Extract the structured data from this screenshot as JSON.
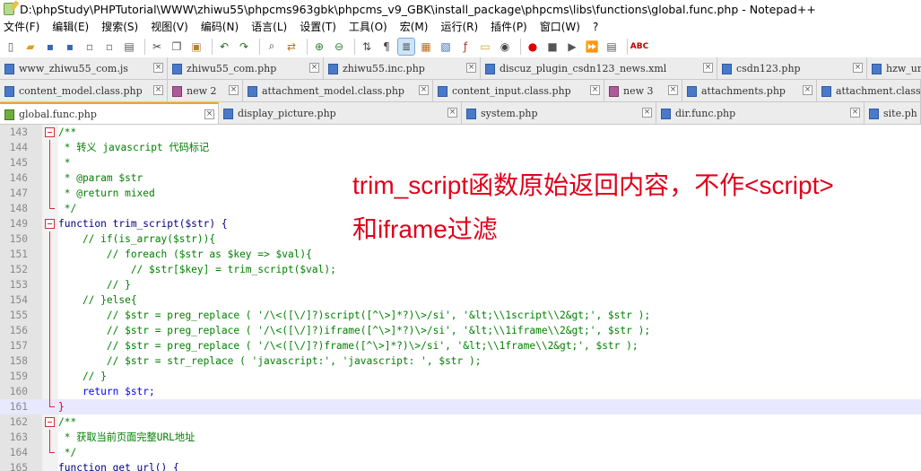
{
  "window": {
    "title": "D:\\phpStudy\\PHPTutorial\\WWW\\zhiwu55\\phpcms963gbk\\phpcms_v9_GBK\\install_package\\phpcms\\libs\\functions\\global.func.php - Notepad++"
  },
  "menu": {
    "items": [
      "文件(F)",
      "编辑(E)",
      "搜索(S)",
      "视图(V)",
      "编码(N)",
      "语言(L)",
      "设置(T)",
      "工具(O)",
      "宏(M)",
      "运行(R)",
      "插件(P)",
      "窗口(W)",
      "?"
    ]
  },
  "toolbar": {
    "icons": [
      "new-file-icon",
      "open-file-icon",
      "save-icon",
      "save-all-icon",
      "close-icon",
      "close-all-icon",
      "print-icon",
      "cut-icon",
      "copy-icon",
      "paste-icon",
      "undo-icon",
      "redo-icon",
      "find-icon",
      "replace-icon",
      "zoom-in-icon",
      "zoom-out-icon",
      "sync-v-icon",
      "sync-h-icon",
      "wrap-icon",
      "show-all-icon",
      "indent-guide-icon",
      "lang-icon",
      "doc-map-icon",
      "function-list-icon",
      "folder-icon",
      "monitor-icon",
      "record-icon",
      "stop-icon",
      "play-icon",
      "play-multi-icon",
      "save-macro-icon",
      "spellcheck-icon"
    ]
  },
  "tabs": {
    "row1": [
      "www_zhiwu55_com.js",
      "zhiwu55_com.php",
      "zhiwu55.inc.php",
      "discuz_plugin_csdn123_news.xml",
      "csdn123.php",
      "hzw_url_a"
    ],
    "row2": [
      "content_model.class.php",
      "new 2",
      "attachment_model.class.php",
      "content_input.class.php",
      "new 3",
      "attachments.php",
      "attachment.class"
    ],
    "row3": [
      "global.func.php",
      "display_picture.php",
      "system.php",
      "dir.func.php",
      "site.ph"
    ]
  },
  "editor": {
    "lines": [
      {
        "n": "143",
        "t": "/**"
      },
      {
        "n": "144",
        "t": " * 转义 javascript 代码标记"
      },
      {
        "n": "145",
        "t": " *"
      },
      {
        "n": "146",
        "t": " * @param $str"
      },
      {
        "n": "147",
        "t": " * @return mixed"
      },
      {
        "n": "148",
        "t": " */"
      },
      {
        "n": "149",
        "t": "function trim_script($str) {"
      },
      {
        "n": "150",
        "t": "    // if(is_array($str)){"
      },
      {
        "n": "151",
        "t": "        // foreach ($str as $key => $val){"
      },
      {
        "n": "152",
        "t": "            // $str[$key] = trim_script($val);"
      },
      {
        "n": "153",
        "t": "        // }"
      },
      {
        "n": "154",
        "t": "    // }else{"
      },
      {
        "n": "155",
        "t": "        // $str = preg_replace ( '/\\<([\\/]?)script([^\\>]*?)\\>/si', '&lt;\\\\1script\\\\2&gt;', $str );"
      },
      {
        "n": "156",
        "t": "        // $str = preg_replace ( '/\\<([\\/]?)iframe([^\\>]*?)\\>/si', '&lt;\\\\1iframe\\\\2&gt;', $str );"
      },
      {
        "n": "157",
        "t": "        // $str = preg_replace ( '/\\<([\\/]?)frame([^\\>]*?)\\>/si', '&lt;\\\\1frame\\\\2&gt;', $str );"
      },
      {
        "n": "158",
        "t": "        // $str = str_replace ( 'javascript:', 'javascript: ', $str );"
      },
      {
        "n": "159",
        "t": "    // }"
      },
      {
        "n": "160",
        "t": "    return $str;"
      },
      {
        "n": "161",
        "t": "}"
      },
      {
        "n": "162",
        "t": "/**"
      },
      {
        "n": "163",
        "t": " * 获取当前页面完整URL地址"
      },
      {
        "n": "164",
        "t": " */"
      },
      {
        "n": "165",
        "t": "function get_url() {"
      }
    ]
  },
  "annotation": {
    "line1": "trim_script函数原始返回内容，不作<script>",
    "line2": "和iframe过滤"
  },
  "colors": {
    "comment": "#008000",
    "keyword": "#0000ff",
    "annotation": "#e0001b",
    "fold_marker": "#d03030"
  }
}
